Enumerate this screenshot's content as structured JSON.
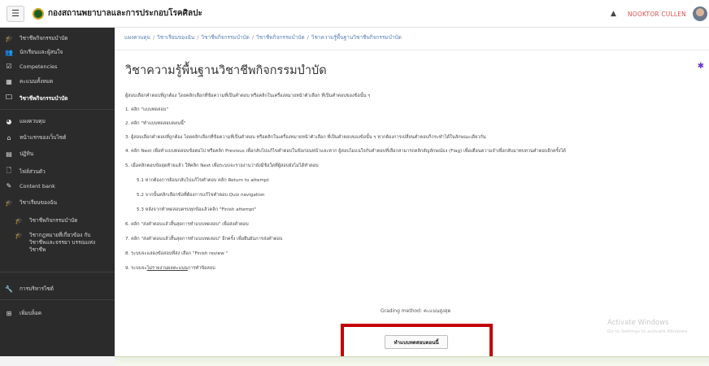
{
  "header": {
    "menu_icon": "hamburger-icon",
    "site_title": "กองสถานพยาบาลและการประกอบโรคศิลปะ",
    "bell_icon": "bell-icon",
    "user_name": "NOOKTOR CULLEN"
  },
  "sidebar": {
    "items": [
      {
        "icon": "graduation-cap-icon",
        "glyph": "🎓",
        "label": "วิชาชีพกิจกรรมบำบัด"
      },
      {
        "icon": "users-icon",
        "glyph": "👥",
        "label": "นักเรียนและผู้สนใจ"
      },
      {
        "icon": "check-square-icon",
        "glyph": "☑",
        "label": "Competencies"
      },
      {
        "icon": "table-icon",
        "glyph": "▦",
        "label": "คะแนนทั้งหมด"
      },
      {
        "icon": "folder-icon",
        "glyph": "🗀",
        "label": "วิชาชีพกิจกรรมบำบัด"
      },
      {
        "icon": "dashboard-icon",
        "glyph": "◕",
        "label": "แผงควบคุม"
      },
      {
        "icon": "home-icon",
        "glyph": "⌂",
        "label": "หน้าแรกของเว็บไซต์"
      },
      {
        "icon": "calendar-icon",
        "glyph": "▤",
        "label": "ปฏิทิน"
      },
      {
        "icon": "file-icon",
        "glyph": "🗋",
        "label": "ไฟล์ส่วนตัว"
      },
      {
        "icon": "pencil-icon",
        "glyph": "✎",
        "label": "Content bank"
      },
      {
        "icon": "graduation-cap-icon",
        "glyph": "🎓",
        "label": "วิชาเรียนของฉัน"
      },
      {
        "icon": "graduation-cap-icon",
        "glyph": "🎓",
        "label": "วิชาชีพกิจกรรมบำบัด"
      },
      {
        "icon": "graduation-cap-icon",
        "glyph": "🎓",
        "label": "วิชากฎหมายที่เกี่ยวข้อง กับวิชาชีพและจรรยา บรรณแห่งวิชาชีพ"
      },
      {
        "icon": "wrench-icon",
        "glyph": "🔧",
        "label": "การบริหารไซต์"
      },
      {
        "icon": "plus-square-icon",
        "glyph": "⊞",
        "label": "เพิ่มบล็อค"
      }
    ]
  },
  "breadcrumb": [
    "แผงควบคุม",
    "วิชาเรียนของฉัน",
    "วิชาชีพกิจกรรมบำบัด",
    "วิชาชีพกิจกรรมบำบัด",
    "วิชาความรู้พื้นฐานวิชาชีพกิจกรรมบำบัด"
  ],
  "main": {
    "title": "วิชาความรู้พื้นฐานวิชาชีพกิจกรรมบำบัด",
    "settings_icon": "gear-icon",
    "instructions": [
      "ผู้สอบเลือกคำตอบที่ถูกต้อง โดยคลิกเลือกที่ข้อความที่เป็นคำตอบ หรือคลิกในเครื่องหมายหน้าตัวเลือก ที่เป็นคำตอบของข้อนั้น ๆ",
      "1. คลิก \"แบบทดสอบ\"",
      "2. คลิก \"ทำแบบทดสอบตอนนี้\"",
      "3. ผู้สอบเลือกคำตอบที่ถูกต้อง โดยคลิกเลือกที่ข้อความที่เป็นคำตอบ หรือคลิกในเครื่องหมายหน้าตัวเลือก ที่เป็นคำตอบของข้อนั้น ๆ หากต้องการเปลี่ยนคำตอบก็กระทำได้ในลักษณะเดียวกัน",
      "4. คลิก Next เพื่อทำแบบทดสอบข้อต่อไป หรือคลิก Previous เพื่อกลับไปแก้ไขคำตอบในข้อก่อนหน้าและหาก ผู้สอบไม่แน่ใจกับคำตอบที่เลือกสามารถคลิกสัญลักษณ์ธง (Flag) เพื่อเตือนความจำเพื่อกลับมาทบทวนคำตอบอีกครั้งได้",
      "5. เมื่อคลิกตอบข้อสุดท้ายแล้ว ให้คลิก Next เพื่อระบบจะรายงานว่ายังมีข้อใดที่ผู้สอบยังไม่ได้ทำตอบ",
      "5.1 หากต้องการย้อนกลับไปแก้ไขคำตอบ คลิก Return to attempt",
      "5.2 จากนั้นคลิกเลือกข้อที่ต้องการแก้ไขคำตอบ Quiz navigation",
      "5.3 หลังจากทำทดสอบครบทุกข้อแล้วคลิก \"Finish attempt\"",
      "6. คลิก \"ส่งคำตอบแล้วสิ้นสุดการทำแบบทดสอบ\" เพื่อส่งคำตอบ",
      "7. คลิก \"ส่งคำตอบแล้วสิ้นสุดการทำแบบทดสอบ\" อีกครั้ง เพื่อยืนยันการส่งคำตอบ",
      "8. ระบบจะแสดงข้อสอบที่ส่ง เลือก \"Finish review \"",
      "9. ระบบจะ",
      "ไม่รายงานผลคะแนน",
      "การทำข้อสอบ"
    ],
    "grading_method": "Grading method: คะแนนสูงสุด",
    "attempt_button": "ทำแบบทดสอบตอนนี้"
  },
  "watermark": {
    "title": "Activate Windows",
    "subtitle": "Go to Settings to activate Windows."
  },
  "colors": {
    "sidebar_bg": "#2b2b2b",
    "link": "#5a7fb5",
    "highlight": "#c20000",
    "settings_icon": "#6a39c9"
  }
}
